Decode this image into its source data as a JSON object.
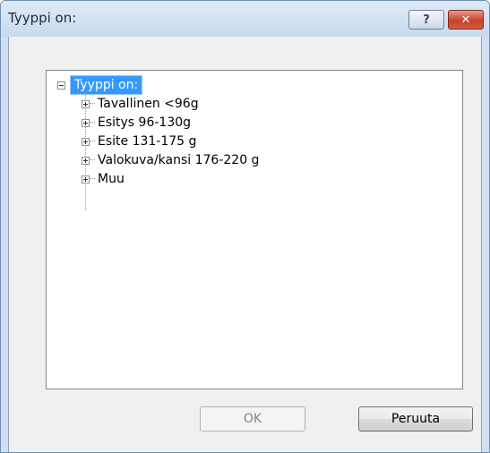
{
  "window": {
    "title": "Tyyppi on:",
    "help_label": "?",
    "close_label": "✕"
  },
  "tree": {
    "root": {
      "label": "Tyyppi on:",
      "expanded": true,
      "selected": true
    },
    "items": [
      {
        "label": "Tavallinen <96g",
        "expanded": false
      },
      {
        "label": "Esitys 96-130g",
        "expanded": false
      },
      {
        "label": "Esite 131-175 g",
        "expanded": false
      },
      {
        "label": "Valokuva/kansi 176-220 g",
        "expanded": false
      },
      {
        "label": "Muu",
        "expanded": false
      }
    ]
  },
  "buttons": {
    "ok_label": "OK",
    "ok_enabled": false,
    "cancel_label": "Peruuta"
  },
  "colors": {
    "selection": "#3399ff",
    "title_bar": "#cfe0f2",
    "close_button": "#c6422c"
  }
}
